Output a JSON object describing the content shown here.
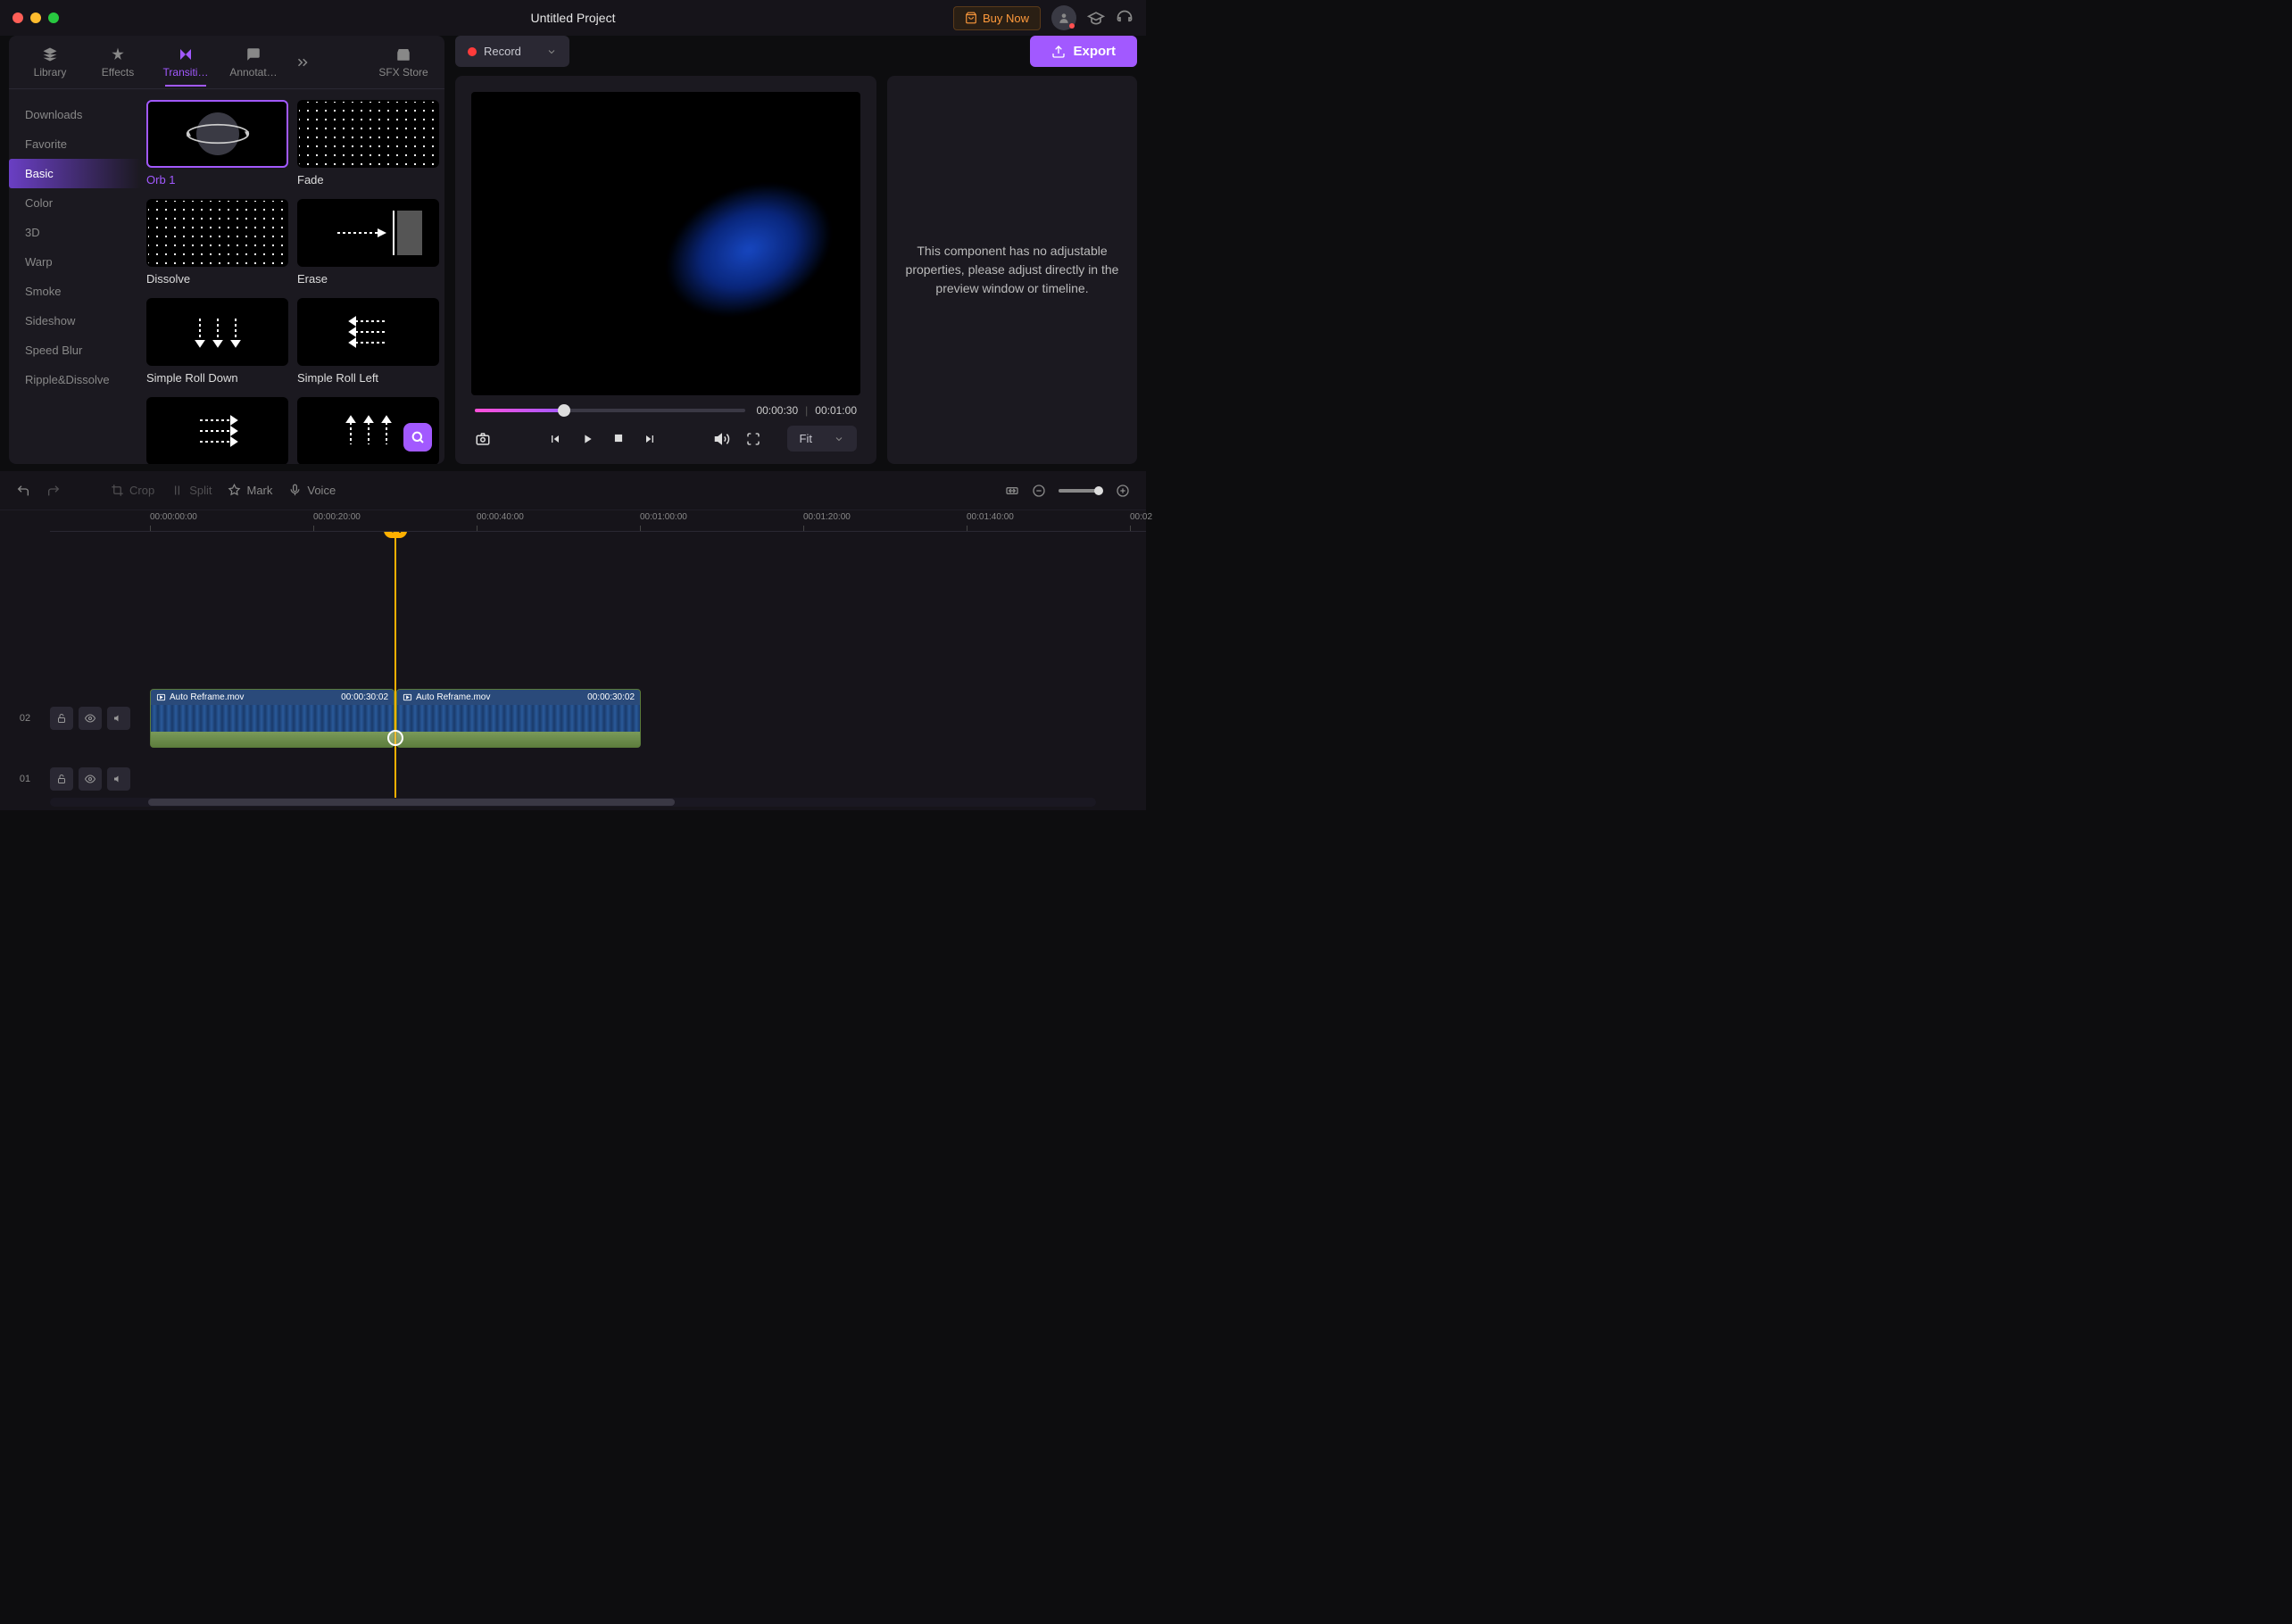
{
  "title": "Untitled Project",
  "buy_now": "Buy Now",
  "export": "Export",
  "tabs": {
    "library": "Library",
    "effects": "Effects",
    "transitions": "Transiti…",
    "annotations": "Annotat…",
    "sfx": "SFX Store"
  },
  "categories": [
    "Downloads",
    "Favorite",
    "Basic",
    "Color",
    "3D",
    "Warp",
    "Smoke",
    "Sideshow",
    "Speed Blur",
    "Ripple&Dissolve"
  ],
  "transitions": [
    {
      "label": "Orb 1"
    },
    {
      "label": "Fade"
    },
    {
      "label": "Dissolve"
    },
    {
      "label": "Erase"
    },
    {
      "label": "Simple Roll Down"
    },
    {
      "label": "Simple Roll Left"
    },
    {
      "label": ""
    },
    {
      "label": ""
    }
  ],
  "record": "Record",
  "preview": {
    "current_time": "00:00:30",
    "total_time": "00:01:00",
    "fit": "Fit"
  },
  "properties_msg": "This component has no adjustable properties, please adjust directly in the preview window or timeline.",
  "timeline_tools": {
    "crop": "Crop",
    "split": "Split",
    "mark": "Mark",
    "voice": "Voice"
  },
  "ruler": [
    "00:00:00:00",
    "00:00:20:00",
    "00:00:40:00",
    "00:01:00:00",
    "00:01:20:00",
    "00:01:40:00",
    "00:02"
  ],
  "playhead": "⫞⫣",
  "tracks": {
    "t02": "02",
    "t01": "01"
  },
  "clips": [
    {
      "name": "Auto Reframe.mov",
      "duration": "00:00:30:02"
    },
    {
      "name": "Auto Reframe.mov",
      "duration": "00:00:30:02"
    }
  ]
}
